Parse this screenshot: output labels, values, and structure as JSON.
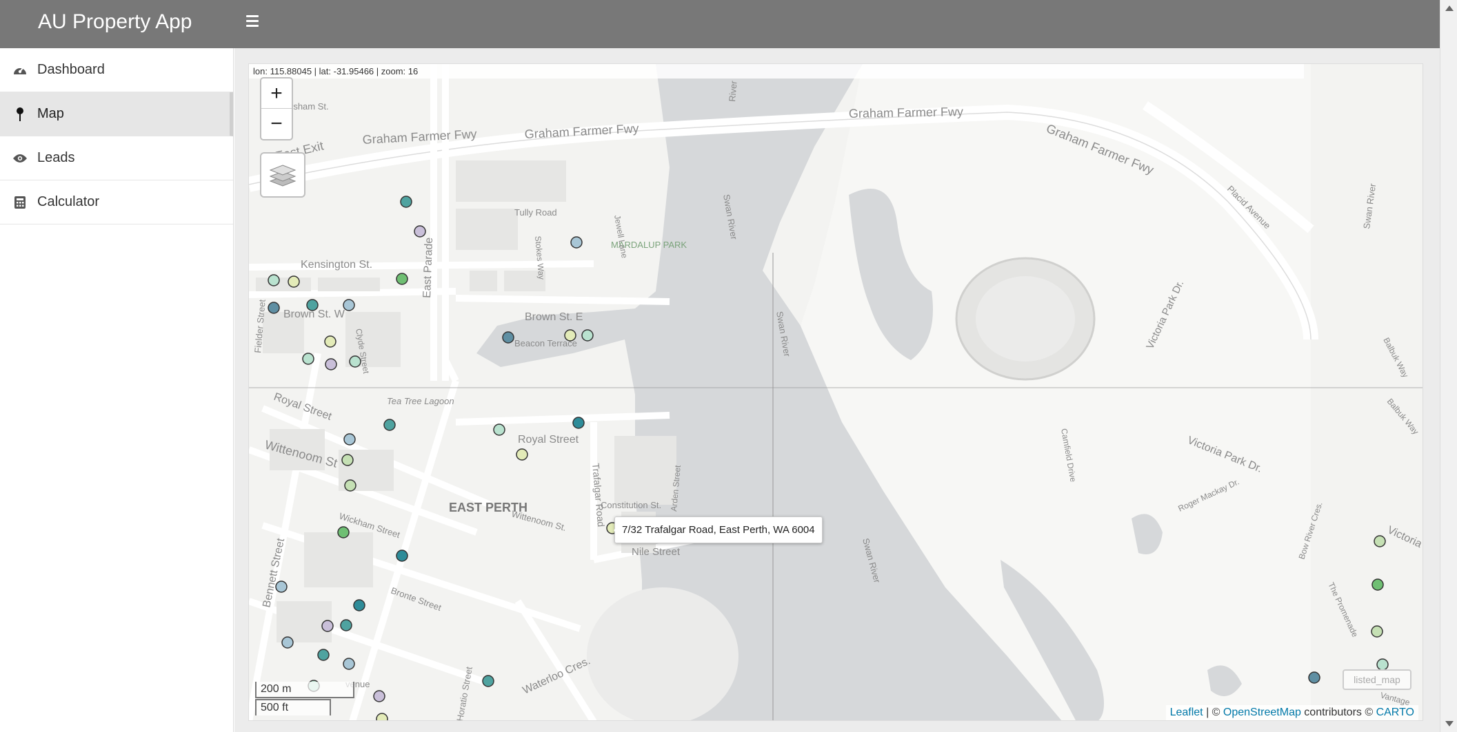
{
  "app": {
    "title": "AU Property App"
  },
  "sidebar": {
    "items": [
      {
        "label": "Dashboard",
        "icon": "dashboard-icon",
        "active": false
      },
      {
        "label": "Map",
        "icon": "map-pin-icon",
        "active": true
      },
      {
        "label": "Leads",
        "icon": "eye-icon",
        "active": false
      },
      {
        "label": "Calculator",
        "icon": "calculator-icon",
        "active": false
      }
    ]
  },
  "map": {
    "coord_readout": "lon: 115.88045 | lat: -31.95466 | zoom: 16",
    "zoom_in": "+",
    "zoom_out": "−",
    "tooltip": "7/32 Trafalgar Road, East Perth, WA 6004",
    "scale_metric": "200 m",
    "scale_imperial": "500 ft",
    "layer_label": "listed_map",
    "attribution": {
      "leaflet": "Leaflet",
      "sep1": " | © ",
      "osm": "OpenStreetMap",
      "mid": " contributors © ",
      "carto": "CARTO"
    },
    "labels": {
      "graham_farmer_fwy": "Graham Farmer Fwy",
      "east_exit": "East Exit",
      "mardalup_park": "MARDALUP PARK",
      "swan_river": "Swan River",
      "river": "River",
      "tully_road": "Tully Road",
      "jewell_lane": "Jewell Lane",
      "stokes_way": "Stokes Way",
      "kensington_st": "Kensington St.",
      "east_parade": "East Parade",
      "brown_st_w": "Brown St. W",
      "brown_st_e": "Brown St. E",
      "beacon_terrace": "Beacon Terrace",
      "fielder_street": "Fielder Street",
      "clyde_street": "Clyde Street",
      "tea_tree_lagoon": "Tea Tree Lagoon",
      "royal_street_w": "Royal Street",
      "royal_street_e": "Royal Street",
      "wittenoom_st": "Wittenoom St",
      "wittenoom_st2": "Wittenoom St.",
      "east_perth": "EAST PERTH",
      "trafalgar_road": "Trafalgar Road",
      "constitution_st": "Constitution St.",
      "arden_street": "Arden Street",
      "wickham_street": "Wickham Street",
      "nile_street": "Nile Street",
      "bennett_street": "Bennett Street",
      "bronte_street": "Bronte Street",
      "waterloo_cres": "Waterloo Cres.",
      "horatio_street": "Horatio Street",
      "placid_avenue": "Placid Avenue",
      "victoria_park_dr": "Victoria Park Dr.",
      "victoria_park_dr2": "Victoria Park Dr.",
      "camfield_drive": "Camfield Drive",
      "roger_mackay_dr": "Roger Mackay Dr.",
      "bow_river_cres": "Bow River Cres.",
      "the_promenade": "The Promenade",
      "vantage": "Vantage",
      "victoria": "Victoria",
      "balbuk_way": "Balbuk Way",
      "balbuk_way2": "Balbuk Way",
      "ursham_st": "rsham St.",
      "venue": "venue"
    },
    "marker_colors": {
      "light_green": "#c5e0b4",
      "mint": "#b9e2cf",
      "teal": "#4fa3a0",
      "green": "#6fbf73",
      "dark_teal": "#2e8c99",
      "lavender": "#c9bfd9",
      "pale_yellow": "#e3ebb8",
      "pale_blue": "#a8c6d6",
      "steel": "#5f8fa3"
    }
  }
}
